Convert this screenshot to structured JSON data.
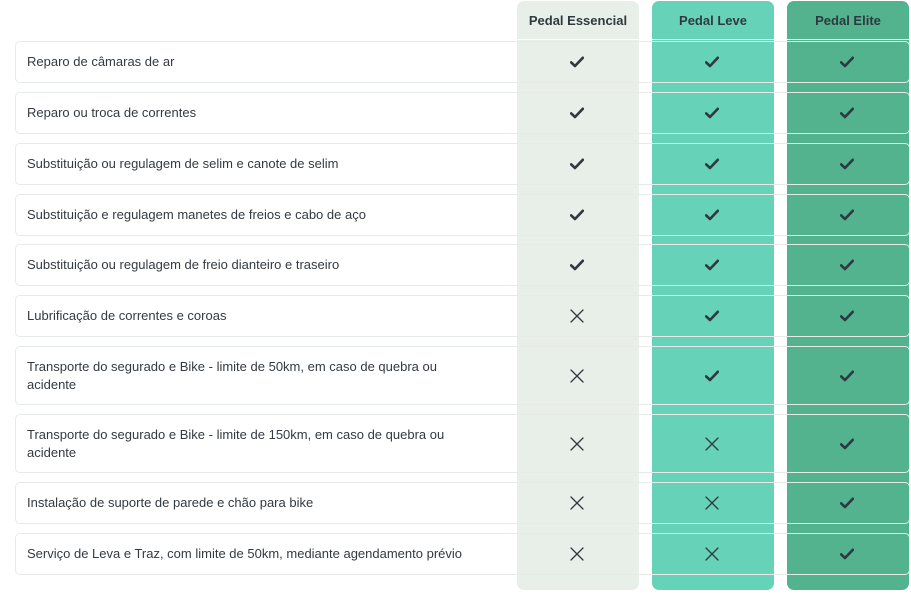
{
  "plans": [
    {
      "name": "Pedal Essencial",
      "color": "#e8efe8"
    },
    {
      "name": "Pedal Leve",
      "color": "#66d3b8"
    },
    {
      "name": "Pedal Elite",
      "color": "#52b38e"
    }
  ],
  "rows": [
    {
      "label": "Reparo de câmaras de ar",
      "values": [
        "check",
        "check",
        "check"
      ]
    },
    {
      "label": "Reparo ou troca de correntes",
      "values": [
        "check",
        "check",
        "check"
      ]
    },
    {
      "label": "Substituição ou regulagem de selim e canote de selim",
      "values": [
        "check",
        "check",
        "check"
      ]
    },
    {
      "label": "Substituição e regulagem manetes de freios e cabo de aço",
      "values": [
        "check",
        "check",
        "check"
      ]
    },
    {
      "label": "Substituição ou regulagem de freio dianteiro e traseiro",
      "values": [
        "check",
        "check",
        "check"
      ]
    },
    {
      "label": "Lubrificação de correntes e coroas",
      "values": [
        "cross",
        "check",
        "check"
      ]
    },
    {
      "label": "Transporte do segurado e Bike - limite de 50km, em caso de quebra ou acidente",
      "values": [
        "cross",
        "check",
        "check"
      ]
    },
    {
      "label": "Transporte do segurado e Bike - limite de 150km, em caso de quebra ou acidente",
      "values": [
        "cross",
        "cross",
        "check"
      ]
    },
    {
      "label": "Instalação de suporte de parede e chão para bike",
      "values": [
        "cross",
        "cross",
        "check"
      ]
    },
    {
      "label": "Serviço de Leva e Traz, com limite de 50km, mediante agendamento prévio",
      "values": [
        "cross",
        "cross",
        "check"
      ]
    }
  ],
  "icons": {
    "included": "check-icon",
    "excluded": "cross-icon"
  },
  "colors": {
    "text": "#333a40",
    "mark": "#2f3a40"
  }
}
